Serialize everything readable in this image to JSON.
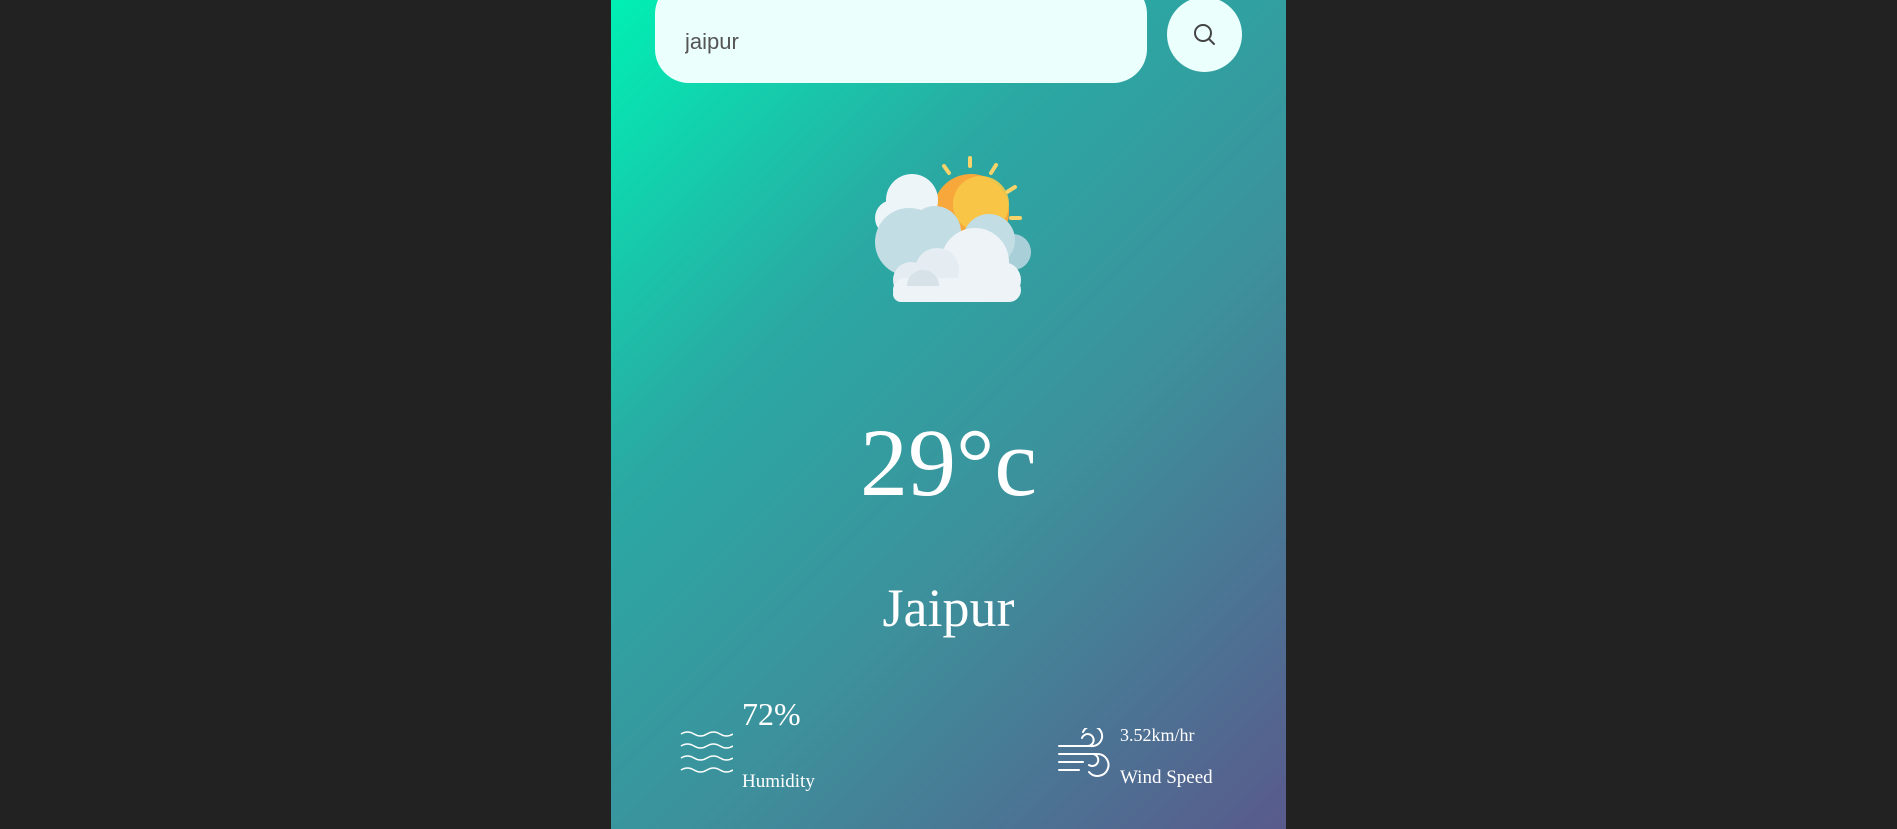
{
  "search": {
    "value": "jaipur",
    "icon": "search-icon"
  },
  "weather": {
    "icon": "partly-cloudy-icon",
    "temperature": "29°c",
    "city": "Jaipur"
  },
  "humidity": {
    "icon": "humidity-waves-icon",
    "value": "72%",
    "label": "Humidity"
  },
  "wind": {
    "icon": "wind-icon",
    "value": "3.52km/hr",
    "label": "Wind Speed"
  },
  "colors": {
    "page_background": "#222222",
    "gradient_start": "#00f0b4",
    "gradient_end": "#595a8c",
    "search_background": "#ebfffc",
    "text": "#ffffff"
  }
}
